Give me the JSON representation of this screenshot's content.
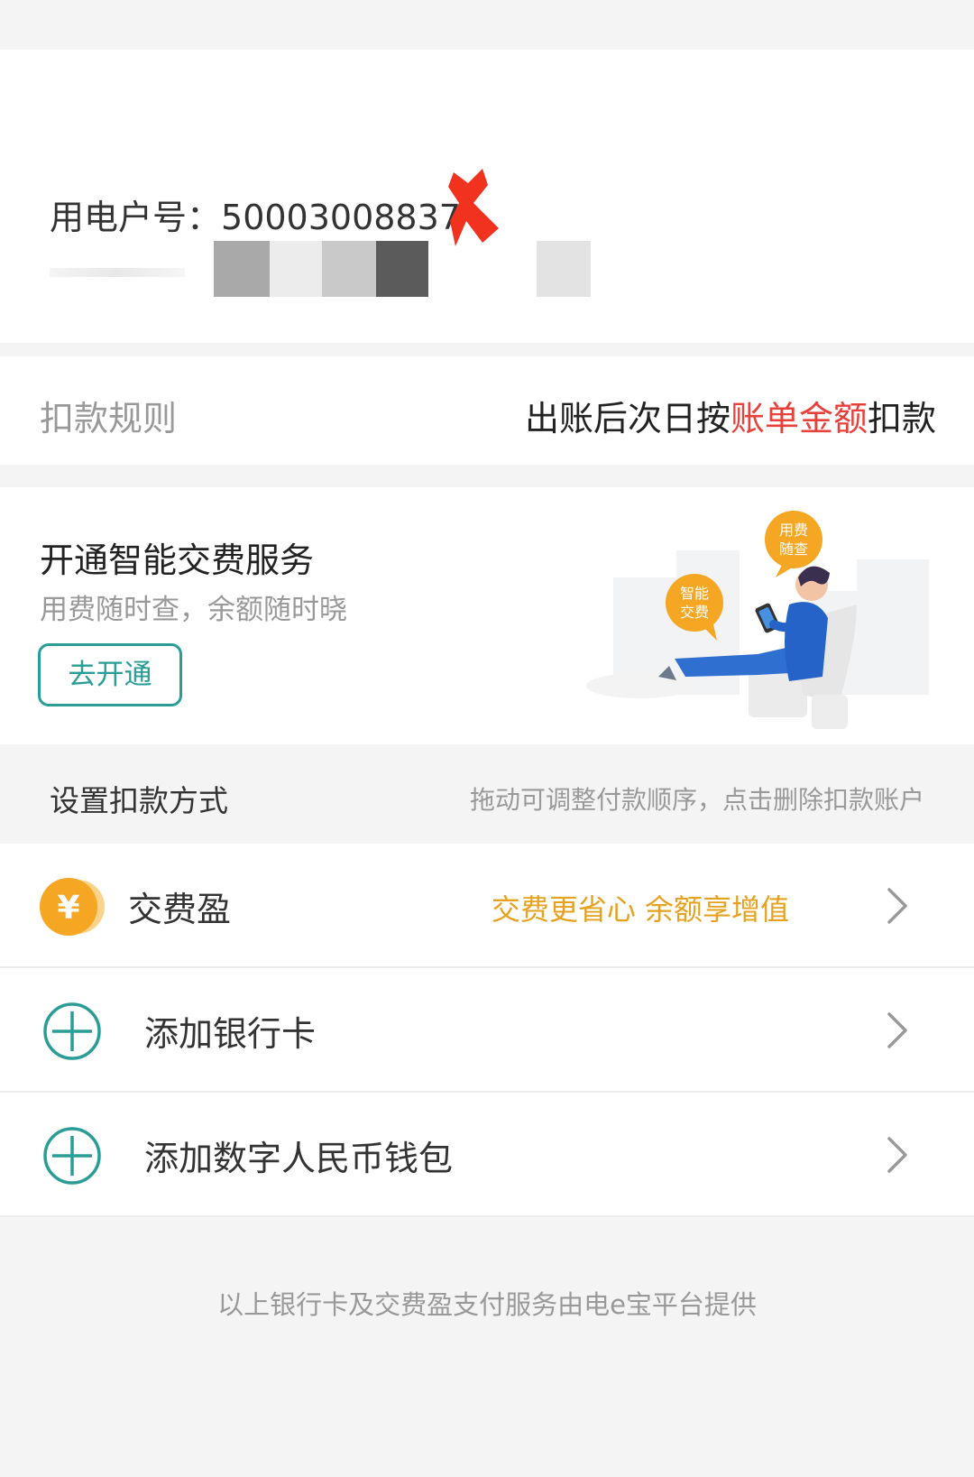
{
  "account": {
    "label": "用电户号：",
    "number": "50003008837"
  },
  "rule": {
    "label": "扣款规则",
    "value_prefix": "出账后次日按",
    "value_accent": "账单金额",
    "value_suffix": "扣款"
  },
  "smart": {
    "title": "开通智能交费服务",
    "subtitle": "用费随时查，余额随时晓",
    "button": "去开通",
    "bubble_left": [
      "智能",
      "交费"
    ],
    "bubble_right": [
      "用费",
      "随查"
    ]
  },
  "payment": {
    "section_title": "设置扣款方式",
    "section_hint": "拖动可调整付款顺序，点击删除扣款账户",
    "items": [
      {
        "label": "交费盈",
        "note": "交费更省心 余额享增值",
        "icon": "yuan-coin-icon"
      },
      {
        "label": "添加银行卡",
        "note": "",
        "icon": "plus-circle-icon"
      },
      {
        "label": "添加数字人民币钱包",
        "note": "",
        "icon": "plus-circle-icon"
      }
    ]
  },
  "footer": {
    "note": "以上银行卡及交费盈支付服务由电e宝平台提供"
  },
  "colors": {
    "accent_red": "#e8403a",
    "teal": "#2a9d96",
    "orange": "#e6a11e",
    "coin": "#f5a623",
    "background": "#f4f4f4"
  }
}
